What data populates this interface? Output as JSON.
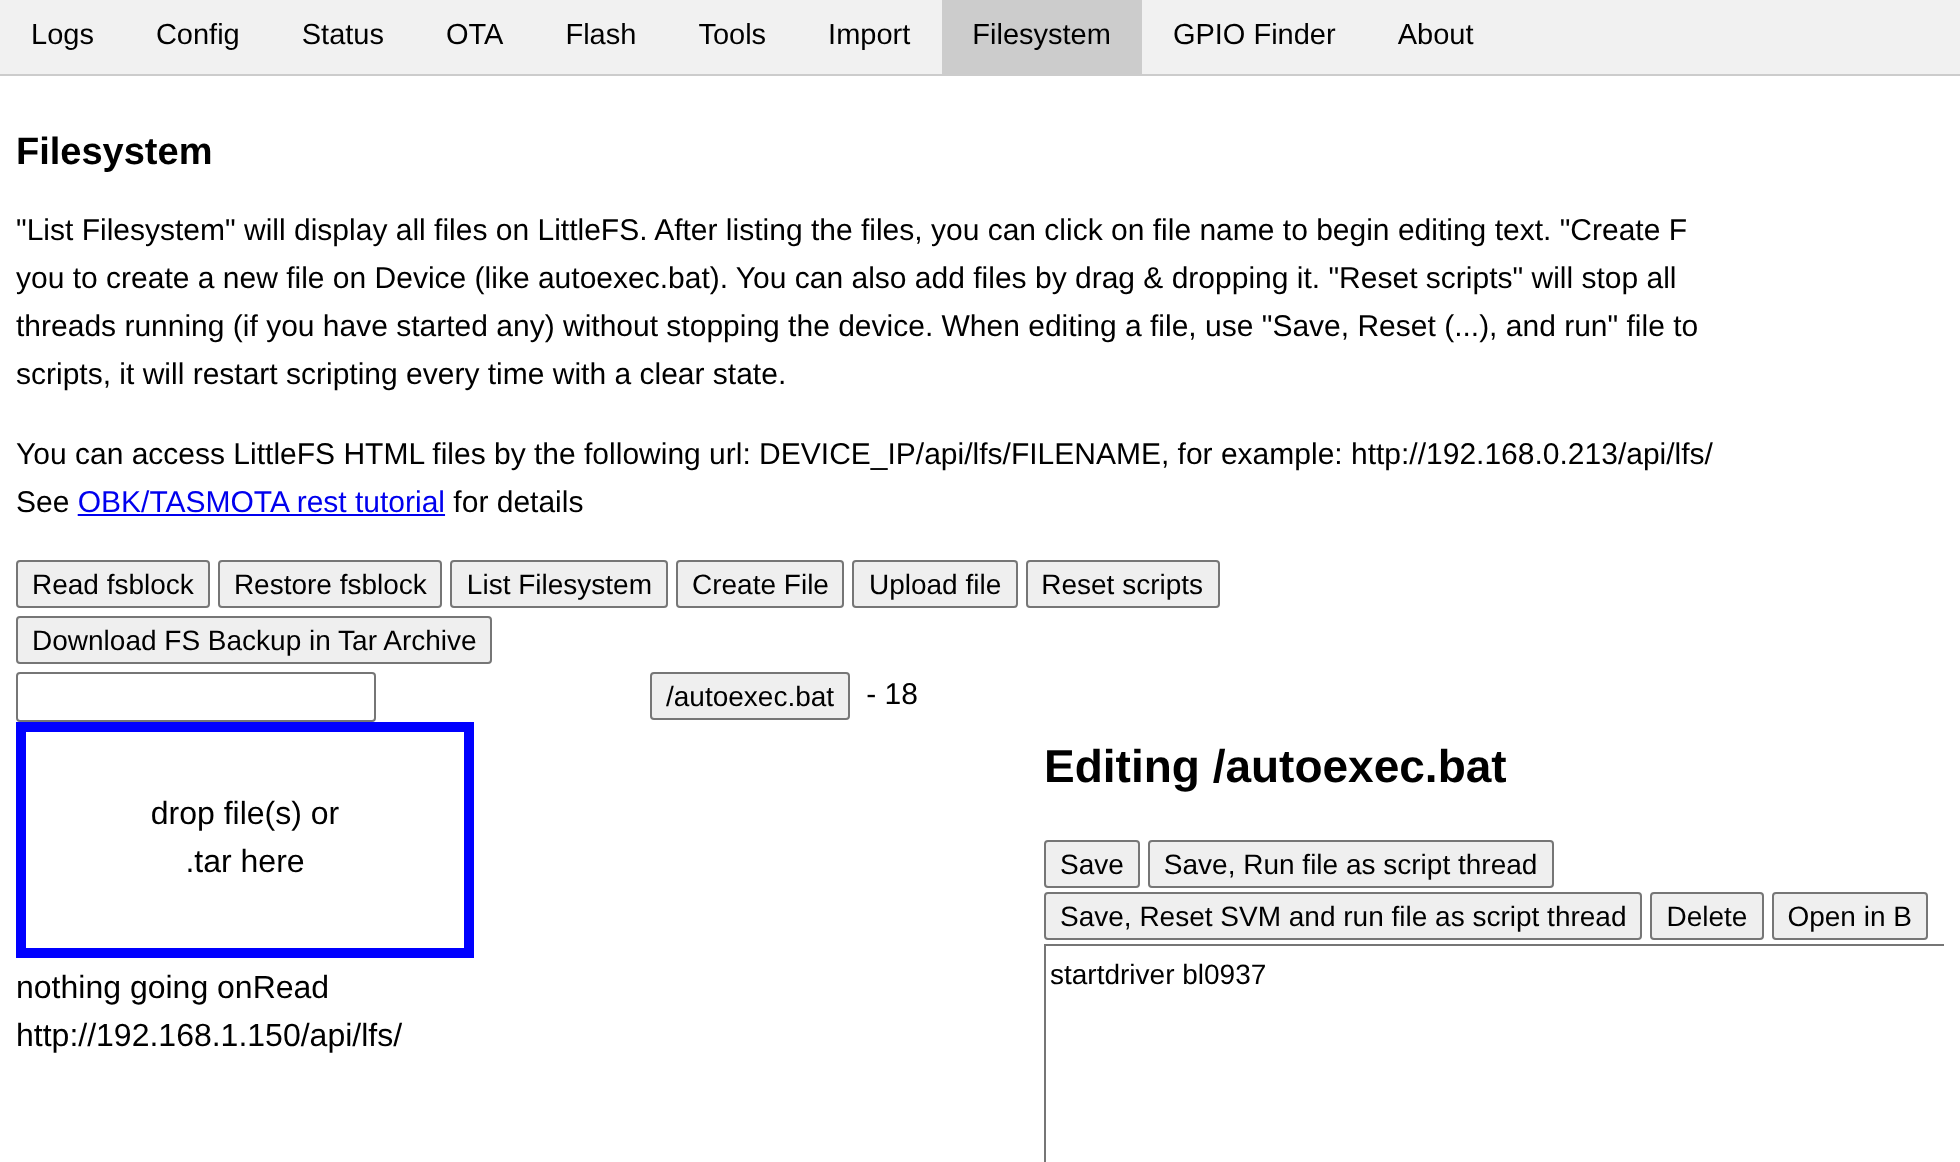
{
  "tabs": [
    {
      "label": "Logs",
      "selected": false
    },
    {
      "label": "Config",
      "selected": false
    },
    {
      "label": "Status",
      "selected": false
    },
    {
      "label": "OTA",
      "selected": false
    },
    {
      "label": "Flash",
      "selected": false
    },
    {
      "label": "Tools",
      "selected": false
    },
    {
      "label": "Import",
      "selected": false
    },
    {
      "label": "Filesystem",
      "selected": true
    },
    {
      "label": "GPIO Finder",
      "selected": false
    },
    {
      "label": "About",
      "selected": false
    }
  ],
  "heading": "Filesystem",
  "intro_lines": [
    "\"List Filesystem\" will display all files on LittleFS. After listing the files, you can click on file name to begin editing text. \"Create F",
    "you to create a new file on Device (like autoexec.bat). You can also add files by drag & dropping it. \"Reset scripts\" will stop all",
    "threads running (if you have started any) without stopping the device. When editing a file, use \"Save, Reset (...), and run\" file to",
    "scripts, it will restart scripting every time with a clear state."
  ],
  "access_line": "You can access LittleFS HTML files by the following url: DEVICE_IP/api/lfs/FILENAME, for example: http://192.168.0.213/api/lfs/",
  "see_line": {
    "before": "See ",
    "link": "OBK/TASMOTA rest tutorial",
    "after": " for details"
  },
  "toolbar_rows": [
    [
      "Read fsblock",
      "Restore fsblock",
      "List Filesystem",
      "Create File",
      "Upload file",
      "Reset scripts"
    ],
    [
      "Download FS Backup in Tar Archive"
    ]
  ],
  "files": [
    {
      "name": "/autoexec.bat",
      "size": "- 18"
    }
  ],
  "drop_zone": {
    "lines": [
      "drop file(s) or",
      ".tar here"
    ]
  },
  "status": "nothing going onRead http://192.168.1.150/api/lfs/",
  "editor": {
    "title": "Editing /autoexec.bat",
    "button_rows": [
      [
        "Save",
        "Save, Run file as script thread"
      ],
      [
        "Save, Reset SVM and run file as script thread",
        "Delete",
        "Open in B"
      ]
    ],
    "content": "startdriver bl0937"
  }
}
